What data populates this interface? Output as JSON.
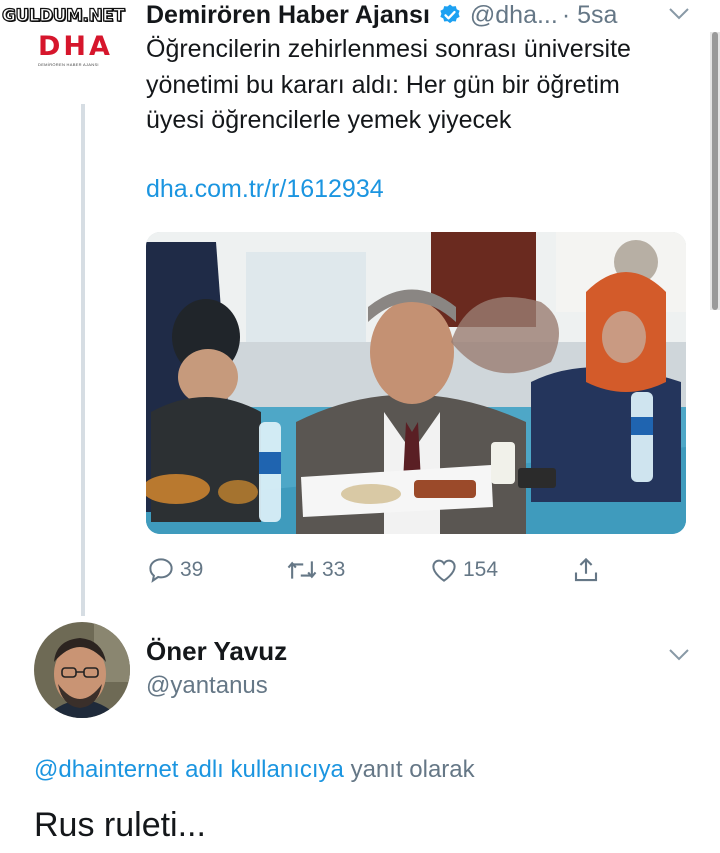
{
  "watermark": "GULDUM.NET",
  "logo": {
    "mark": "DHA",
    "subtitle": "DEMİRÖREN HABER AJANSI"
  },
  "tweet": {
    "author_name": "Demirören Haber Ajansı",
    "author_handle": "@dha...",
    "timestamp": "· 5sa",
    "text": "Öğrencilerin zehirlenmesi sonrası üniversite yönetimi bu kararı aldı: Her gün bir öğretim üyesi öğrencilerle yemek yiyecek",
    "link": "dha.com.tr/r/1612934",
    "actions": {
      "reply_count": "39",
      "retweet_count": "33",
      "like_count": "154"
    }
  },
  "reply": {
    "author_name": "Öner Yavuz",
    "author_handle": "@yantanus",
    "replying_to_mention": "@dhainternet adlı kullanıcıya",
    "replying_to_suffix": "yanıt olarak",
    "text": "Rus ruleti..."
  },
  "colors": {
    "link_blue": "#1b95e0",
    "muted_gray": "#657786",
    "dha_red": "#d6162c",
    "verified_blue": "#1da1f2"
  },
  "icons": [
    "verified-icon",
    "chevron-down-icon",
    "reply-icon",
    "retweet-icon",
    "like-icon",
    "share-icon"
  ]
}
